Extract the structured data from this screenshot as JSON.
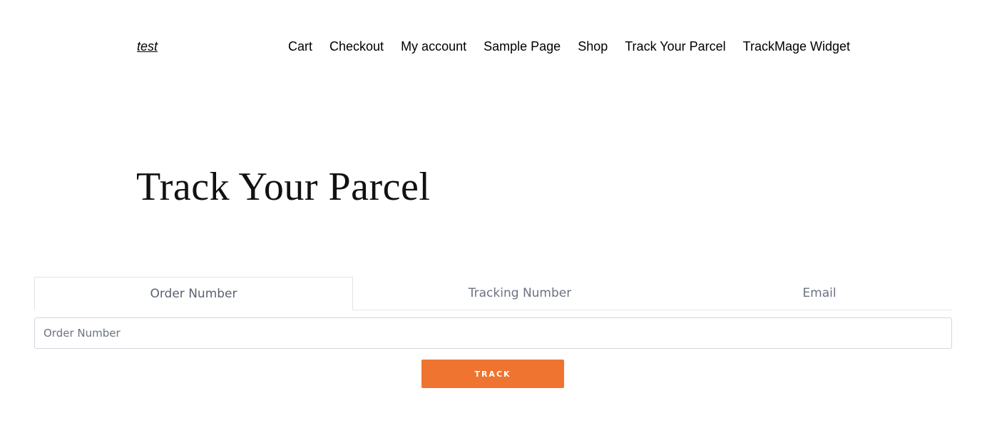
{
  "site": {
    "title": "test"
  },
  "nav": {
    "items": [
      {
        "label": "Cart"
      },
      {
        "label": "Checkout"
      },
      {
        "label": "My account"
      },
      {
        "label": "Sample Page"
      },
      {
        "label": "Shop"
      },
      {
        "label": "Track Your Parcel"
      },
      {
        "label": "TrackMage Widget"
      }
    ]
  },
  "page": {
    "title": "Track Your Parcel"
  },
  "tracker": {
    "tabs": [
      {
        "label": "Order Number",
        "active": true
      },
      {
        "label": "Tracking Number",
        "active": false
      },
      {
        "label": "Email",
        "active": false
      }
    ],
    "input": {
      "value": "",
      "placeholder": "Order Number"
    },
    "button_label": "TRACK"
  },
  "colors": {
    "accent": "#ef7430",
    "tab_text": "#6b7280",
    "border": "#d1d5db"
  }
}
